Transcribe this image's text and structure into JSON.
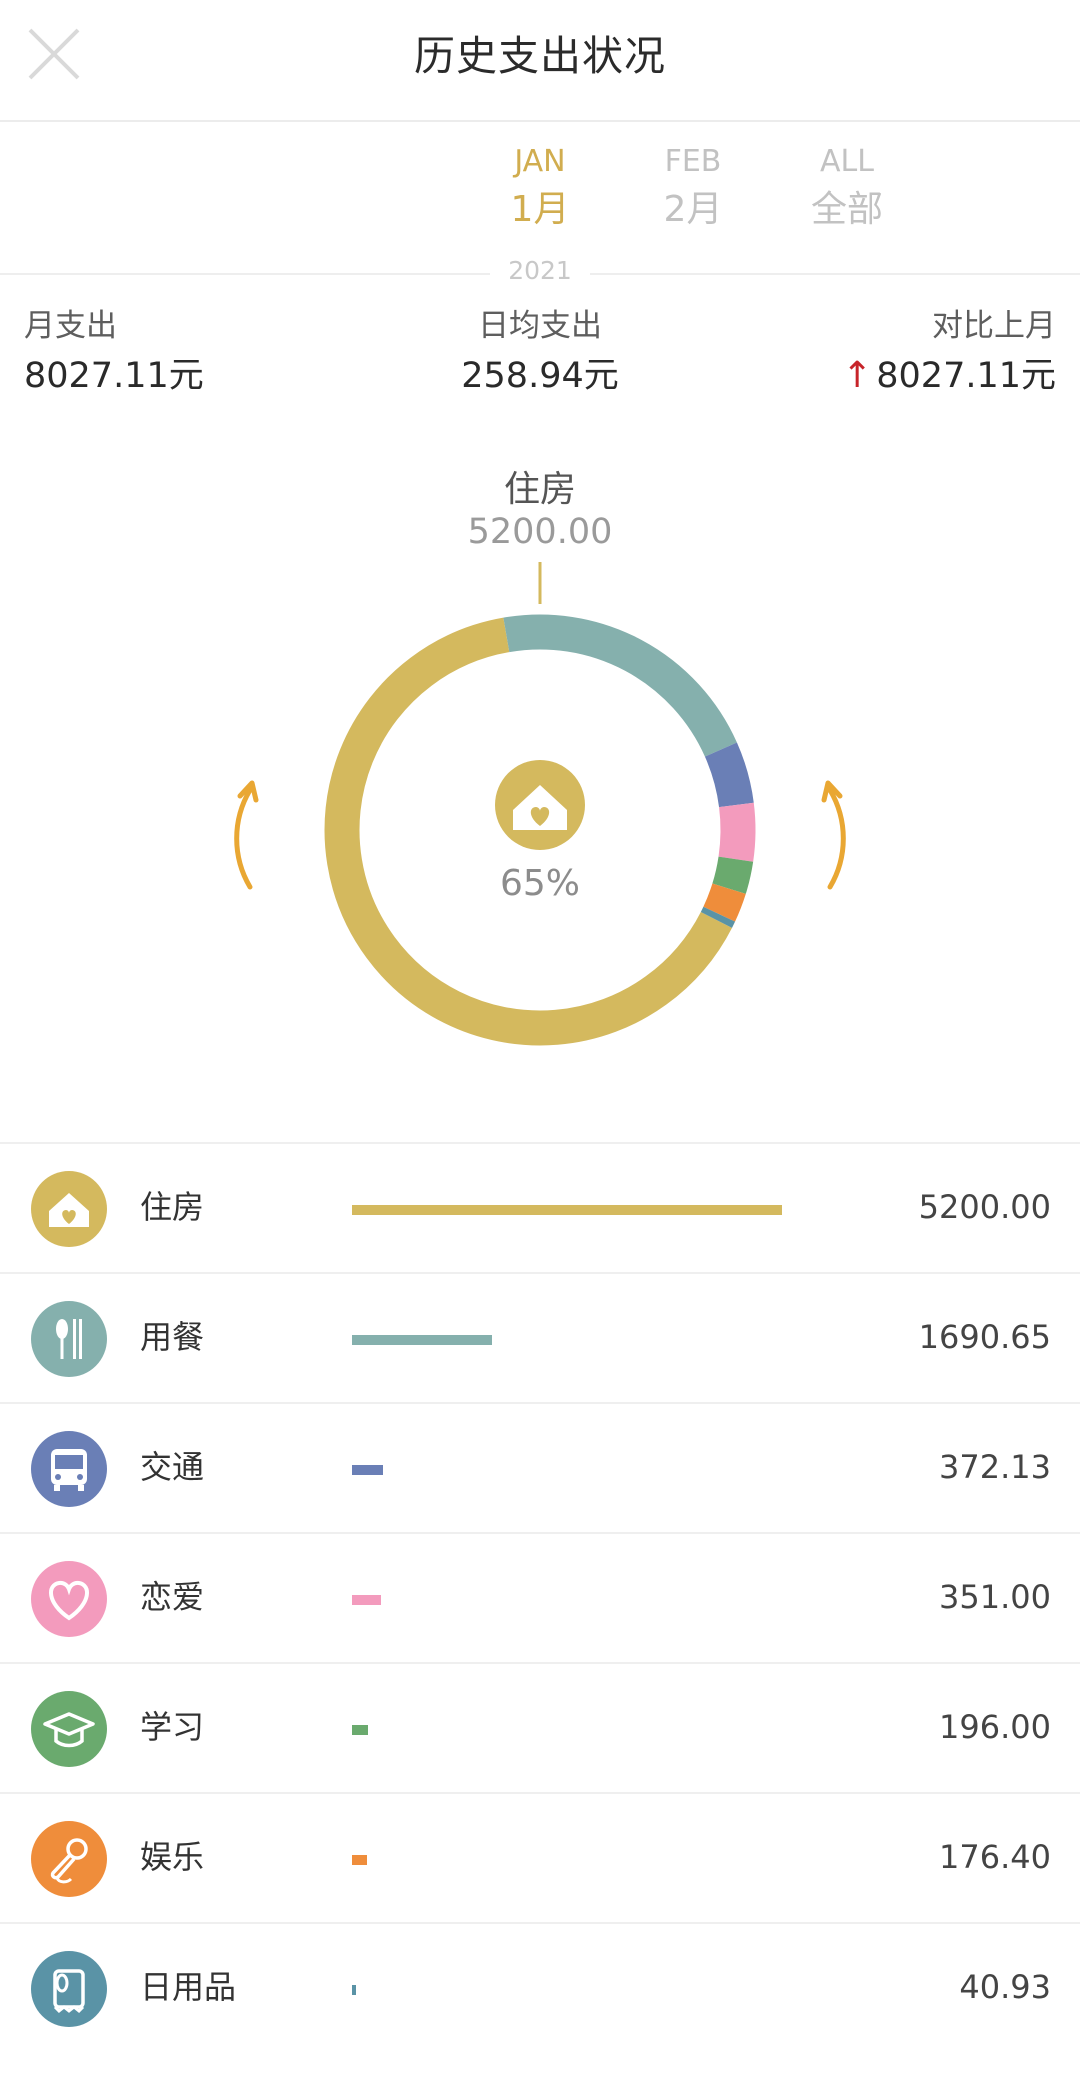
{
  "header": {
    "title": "历史支出状况"
  },
  "tabs": [
    {
      "en": "JAN",
      "cn": "1月",
      "active": true
    },
    {
      "en": "FEB",
      "cn": "2月",
      "active": false
    },
    {
      "en": "ALL",
      "cn": "全部",
      "active": false
    }
  ],
  "year": "2021",
  "stats": {
    "monthly": {
      "label": "月支出",
      "value": "8027.11元"
    },
    "daily_avg": {
      "label": "日均支出",
      "value": "258.94元"
    },
    "vs_last": {
      "label": "对比上月",
      "arrow": "↑",
      "value": "8027.11元"
    }
  },
  "chart_center": {
    "percent": "65%",
    "icon": "house-heart-icon"
  },
  "callout": {
    "name": "住房",
    "value": "5200.00"
  },
  "chart_data": {
    "type": "pie",
    "categories": [
      "住房",
      "用餐",
      "交通",
      "恋爱",
      "学习",
      "娱乐",
      "日用品"
    ],
    "values": [
      5200.0,
      1690.65,
      372.13,
      351.0,
      196.0,
      176.4,
      40.93
    ],
    "colors": [
      "#d4b95e",
      "#85b0ad",
      "#6a7fb6",
      "#f39bbd",
      "#6aaa6e",
      "#ef8d3b",
      "#5a93a6"
    ]
  },
  "categories": [
    {
      "name": "住房",
      "amount": "5200.00",
      "value": 5200.0,
      "color": "#d4b95e",
      "icon": "house-heart-icon"
    },
    {
      "name": "用餐",
      "amount": "1690.65",
      "value": 1690.65,
      "color": "#85b0ad",
      "icon": "spoon-chopsticks-icon"
    },
    {
      "name": "交通",
      "amount": "372.13",
      "value": 372.13,
      "color": "#6a7fb6",
      "icon": "bus-icon"
    },
    {
      "name": "恋爱",
      "amount": "351.00",
      "value": 351.0,
      "color": "#f39bbd",
      "icon": "heart-icon"
    },
    {
      "name": "学习",
      "amount": "196.00",
      "value": 196.0,
      "color": "#6aaa6e",
      "icon": "graduation-cap-icon"
    },
    {
      "name": "娱乐",
      "amount": "176.40",
      "value": 176.4,
      "color": "#ef8d3b",
      "icon": "microphone-icon"
    },
    {
      "name": "日用品",
      "amount": "40.93",
      "value": 40.93,
      "color": "#5a93a6",
      "icon": "toilet-paper-icon"
    }
  ]
}
